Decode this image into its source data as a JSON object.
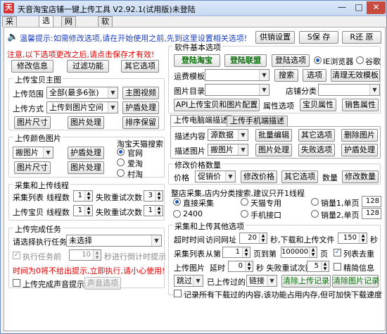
{
  "window": {
    "title": "天音淘宝店铺一键上传工具 V2.92.1(试用版)未登陆",
    "tabs": [
      {
        "label": "采集上传"
      },
      {
        "label": "选项"
      },
      {
        "label": "网页采集"
      },
      {
        "label": "软件信息"
      }
    ]
  },
  "tip": {
    "text": "温馨提示:如需修改选项,请在开始使用之前,先到这里设置相关选项!",
    "note": "注意,以下选项更改之后,请点击保存才有效!",
    "buttons": {
      "supply": "供销设置",
      "save": "S保 存",
      "restore": "R还 原"
    }
  },
  "left_top_buttons": {
    "edit_info": "修改信息",
    "filter": "过滤功能",
    "other": "其它选项"
  },
  "main_image": {
    "caption": "上传宝贝主图",
    "range_label": "上传范围",
    "range_value": "全部(最多6张)",
    "video_btn": "主图视频",
    "method_label": "上传方式",
    "method_value": "上传到图片空间",
    "shield_btn": "护盾处理",
    "size_btn": "图片尺寸",
    "process_btn": "图片处理",
    "sort_btn": "排序保留"
  },
  "color_image": {
    "caption": "上传颜色图片",
    "move_value": "搬图片",
    "shield_btn": "护盾处理",
    "size_btn": "图片尺寸",
    "process_btn": "图片处理"
  },
  "tmall": {
    "caption": "淘宝天猫搜索",
    "options": [
      {
        "label": "官网",
        "selected": true
      },
      {
        "label": "爱淘",
        "selected": false
      },
      {
        "label": "村淘",
        "selected": false
      }
    ]
  },
  "threads": {
    "caption": "采集和上传线程",
    "collect_label": "采集列表",
    "collect_threads_label": "线程数",
    "collect_threads": "1",
    "collect_retry_label": "失败重试次数",
    "collect_retry": "3",
    "upload_label": "上传宝贝",
    "upload_threads_label": "线程数",
    "upload_threads": "1",
    "upload_retry_label": "失败重试次数",
    "upload_retry": "1"
  },
  "finish": {
    "caption": "上传完成任务",
    "choose_label": "请选择执行任务",
    "choose_value": "未选择",
    "exec_before_label": "执行任务前",
    "exec_before_value": "10",
    "countdown_label": "秒进行倒计时提示",
    "warning": "时间为0将不给出提示,立即执行,请小心使用!",
    "sound_label": "上传完成声音提示",
    "sound_btn": "声音选项"
  },
  "software": {
    "caption": "软件基本选项",
    "login_taobao": "登陆淘宝",
    "login_union": "登陆联盟",
    "login_options": "登陆选项",
    "browser_ie": "IE浏览器",
    "browser_chrome": "谷歌",
    "freight_label": "运费模板",
    "search_btn": "搜索",
    "options_btn": "选项",
    "clear_btn": "清理无效模板",
    "dir_label": "图片目录",
    "shop_cat_label": "店铺分类",
    "api_btn": "API上传宝贝和图片配置",
    "attr_label": "属性选项",
    "baby_attr_btn": "宝贝属性",
    "sale_attr_btn": "销售属性"
  },
  "desc_tabs": {
    "pc_tab": "上传电脑端描述",
    "mobile_tab": "上传手机端描述",
    "content_label": "描述内容",
    "content_value": "源数据",
    "batch_edit": "批量编辑",
    "other_options": "其它选项",
    "delete_img": "删除图片",
    "image_label": "描述图片",
    "image_value": "搬图片",
    "img_process": "图片处理",
    "fail_options": "失败选项",
    "shield": "护盾处理"
  },
  "price": {
    "caption": "修改价格数量",
    "price_label": "价格",
    "price_value": "促销价",
    "modify_price": "修改价格",
    "other": "其它选项",
    "qty_label": "数量",
    "modify_qty": "修改数量"
  },
  "shop": {
    "caption": "整店采集,店内分类搜索,建议只开1线程",
    "options": [
      {
        "label": "直接采集",
        "selected": true
      },
      {
        "label": "天猫专用",
        "selected": false
      },
      {
        "label": "销量1,单页",
        "selected": false,
        "value": "128"
      },
      {
        "label": "2400",
        "selected": false
      },
      {
        "label": "手机接口",
        "selected": false
      },
      {
        "label": "销量2,单页",
        "selected": false,
        "value": "128"
      }
    ]
  },
  "collect_other": {
    "caption": "采集和上传其他选项",
    "timeout_label": "超时时间",
    "visit_label": "访问网址",
    "visit_value": "20",
    "download_label": "秒,下载和上传文件",
    "download_value": "150",
    "sec": "秒",
    "list_label": "采集列表",
    "from_label": "从第",
    "from_value": "1",
    "to_label": "页到第",
    "to_value": "100000",
    "page": "页",
    "dedupe_label": "列表去重",
    "dedupe_checked": true,
    "img_label": "上传图片",
    "delay_label": "延时",
    "delay_value": "0",
    "retry_label": "秒 失败重试次数",
    "retry_value": "5",
    "precise_label": "精简信息",
    "precise_checked": false,
    "skip_value": "跳过",
    "uploaded_label": "已上传过的",
    "link_value": "链接",
    "clear_upload": "清除上传记录",
    "clear_image": "清除图片记录",
    "record_label": "记录所有下载过的内容,该功能占用内存,但可加快下载速度"
  }
}
